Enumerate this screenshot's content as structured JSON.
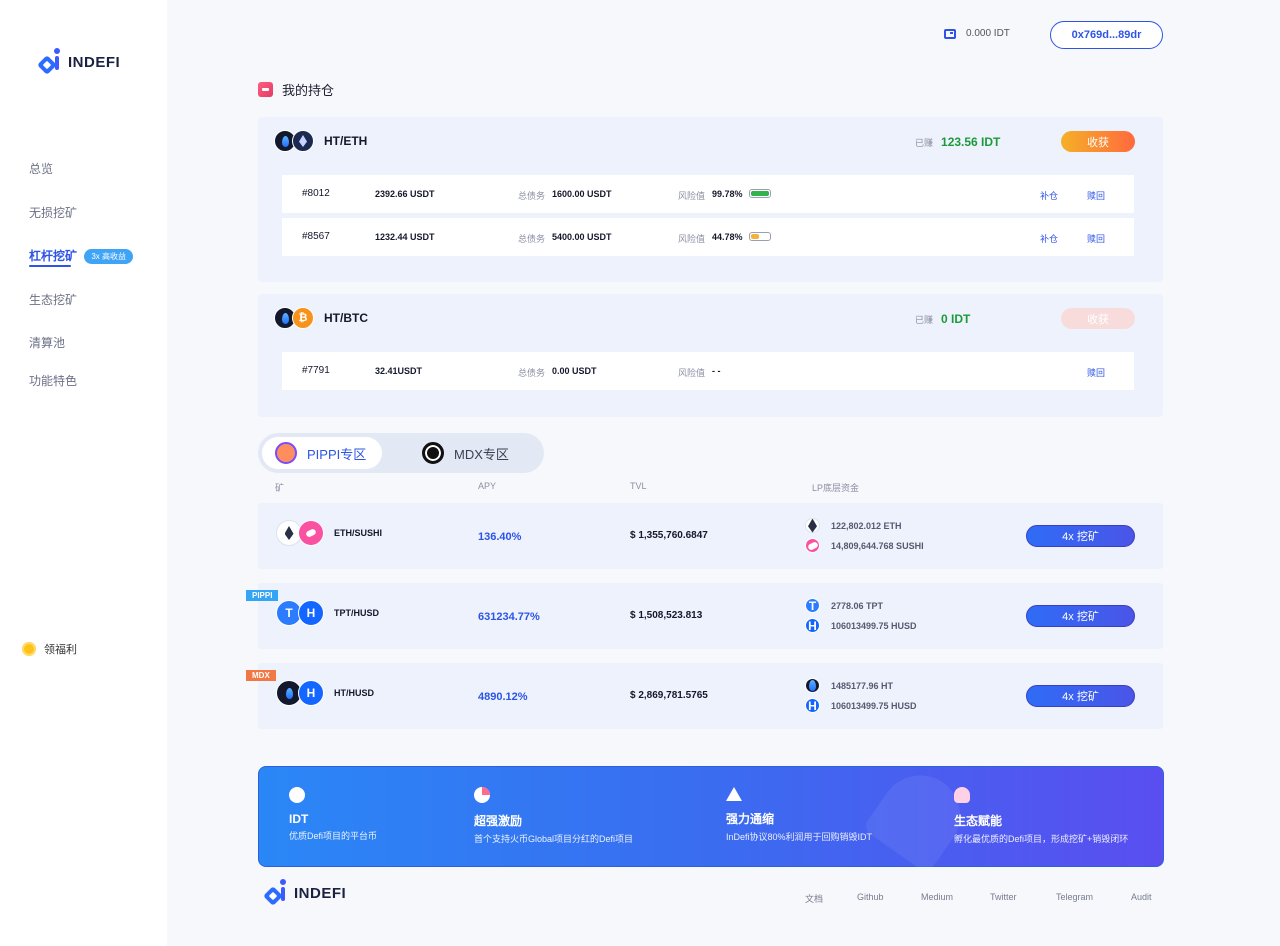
{
  "brand": {
    "name": "INDEFI"
  },
  "sidebar": {
    "items": [
      {
        "label": "总览"
      },
      {
        "label": "无损挖矿"
      },
      {
        "label": "杠杆挖矿",
        "badge": "3x 高收益",
        "active": true
      },
      {
        "label": "生态挖矿"
      },
      {
        "label": "清算池"
      },
      {
        "label": "功能特色"
      }
    ],
    "welfare": "领福利"
  },
  "header": {
    "balance": "0.000 IDT",
    "address": "0x769d...89dr"
  },
  "holdings": {
    "title": "我的持仓",
    "earned_label": "已赚",
    "harvest_label": "收获",
    "debt_label": "总债务",
    "risk_label": "风险值",
    "refill_label": "补仓",
    "redeem_label": "赎回",
    "groups": [
      {
        "pair": "HT/ETH",
        "earned": "123.56 IDT",
        "orders": [
          {
            "id": "#8012",
            "amount": "2392.66 USDT",
            "debt": "1600.00 USDT",
            "risk": "99.78%",
            "risk_level": 0.9978,
            "risk_color": "#2fb34a"
          },
          {
            "id": "#8567",
            "amount": "1232.44 USDT",
            "debt": "5400.00 USDT",
            "risk": "44.78%",
            "risk_level": 0.4478,
            "risk_color": "#f2b33d"
          }
        ]
      },
      {
        "pair": "HT/BTC",
        "earned": "0 IDT",
        "orders": [
          {
            "id": "#7791",
            "amount": "32.41USDT",
            "debt": "0.00 USDT",
            "risk": "- -"
          }
        ]
      }
    ]
  },
  "zones": {
    "tabs": [
      {
        "label": "PIPPI专区",
        "active": true
      },
      {
        "label": "MDX专区"
      }
    ],
    "columns": [
      "矿",
      "APY",
      "TVL",
      "LP底层资金"
    ],
    "rows": [
      {
        "pair": "ETH/SUSHI",
        "apy": "136.40%",
        "tvl": "$ 1,355,760.6847",
        "lp": [
          "122,802.012 ETH",
          "14,809,644.768 SUSHI"
        ],
        "button": "4x 挖矿"
      },
      {
        "tag": "PIPPI",
        "pair": "TPT/HUSD",
        "apy": "631234.77%",
        "tvl": "$ 1,508,523.813",
        "lp": [
          "2778.06 TPT",
          "106013499.75 HUSD"
        ],
        "button": "4x 挖矿"
      },
      {
        "tag": "MDX",
        "pair": "HT/HUSD",
        "apy": "4890.12%",
        "tvl": "$ 2,869,781.5765",
        "lp": [
          "1485177.96 HT",
          "106013499.75 HUSD"
        ],
        "button": "4x 挖矿"
      }
    ]
  },
  "banner": {
    "features": [
      {
        "title": "IDT",
        "desc": "优质Defi项目的平台币"
      },
      {
        "title": "超强激励",
        "desc": "首个支持火币Global项目分红的Defi项目"
      },
      {
        "title": "强力通缩",
        "desc": "InDefi协议80%利润用于回购销毁IDT"
      },
      {
        "title": "生态赋能",
        "desc": "孵化最优质的Defi项目，形成挖矿+销毁闭环"
      }
    ]
  },
  "footer": {
    "links": [
      "文档",
      "Github",
      "Medium",
      "Twitter",
      "Telegram",
      "Audit"
    ]
  }
}
